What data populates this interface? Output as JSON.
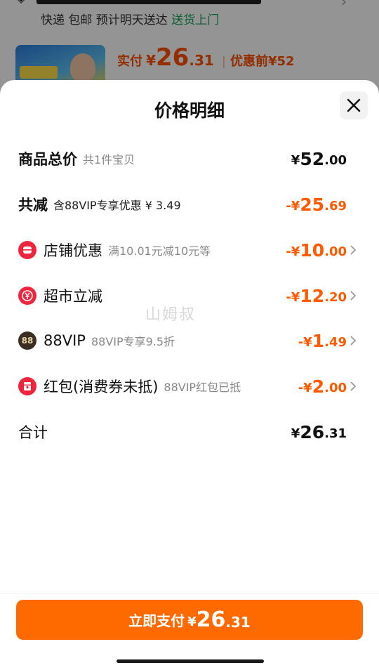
{
  "background": {
    "shipping_prefix": "快递 包邮  预计明天送达 ",
    "shipping_highlight": "送货上门",
    "price_label": "实付",
    "price_currency": "¥",
    "price_int": "26",
    "price_dec": ".31",
    "before_label": "优惠前",
    "before_price": "¥52"
  },
  "sheet": {
    "title": "价格明细",
    "watermark": "山姆叔"
  },
  "rows": [
    {
      "name": "商品总价",
      "sub": "共1件宝贝",
      "cur": "¥",
      "int": "52",
      "dec": ".00"
    },
    {
      "name": "共减",
      "sub": "含88VIP专享优惠 ¥ 3.49",
      "cur": "-¥",
      "int": "25",
      "dec": ".69"
    },
    {
      "name": "店铺优惠",
      "sub": "满10.01元减10元等",
      "cur": "-¥",
      "int": "10",
      "dec": ".00",
      "icon": "shop-coupon-icon"
    },
    {
      "name": "超市立减",
      "sub": "",
      "cur": "-¥",
      "int": "12",
      "dec": ".20",
      "icon": "yuan-discount-icon"
    },
    {
      "name": "88VIP",
      "sub": "88VIP专享9.5折",
      "cur": "-¥",
      "int": "1",
      "dec": ".49",
      "icon": "vip-88-icon",
      "icon_text": "88"
    },
    {
      "name": "红包(消费券未抵)",
      "sub": "88VIP红包已抵",
      "cur": "-¥",
      "int": "2",
      "dec": ".00",
      "icon": "red-packet-icon"
    },
    {
      "name": "合计",
      "sub": "",
      "cur": "¥",
      "int": "26",
      "dec": ".31"
    }
  ],
  "footer": {
    "pay_label": "立即支付",
    "pay_cur": "¥",
    "pay_int": "26",
    "pay_dec": ".31"
  },
  "colors": {
    "accent_orange": "#ff5a00",
    "button_orange": "#ff6a00",
    "badge_red": "#f0243c",
    "vip_badge": "#3a2e22"
  }
}
